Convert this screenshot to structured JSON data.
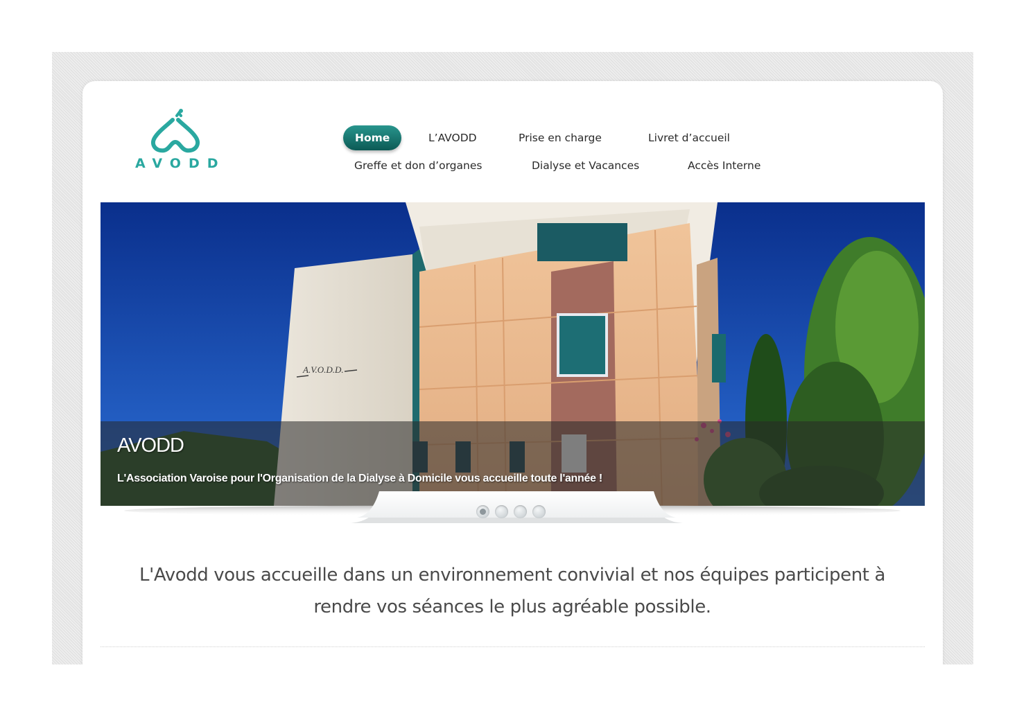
{
  "logo": {
    "text": "AVODD",
    "icon": "avodd-logo-icon",
    "color": "#2aa8a0"
  },
  "nav": {
    "items": [
      {
        "label": "Home",
        "active": true
      },
      {
        "label": "L’AVODD"
      },
      {
        "label": "Prise en charge"
      },
      {
        "label": "Livret d’accueil"
      },
      {
        "label": "Greffe et don d’organes"
      },
      {
        "label": "Dialyse et Vacances"
      },
      {
        "label": "Accès Interne"
      }
    ],
    "active_color": "#1a7a73"
  },
  "slider": {
    "title": "AVODD",
    "subtitle": "L'Association Varoise pour l'Organisation de la Dialyse à Domicile vous accueille toute l'année !",
    "building_sign": "A.V.O.D.D.",
    "dots_count": 4,
    "active_dot": 1
  },
  "intro": {
    "text": "L'Avodd vous accueille dans un environnement convivial et nos équipes participent à rendre vos séances le plus agréable possible."
  }
}
